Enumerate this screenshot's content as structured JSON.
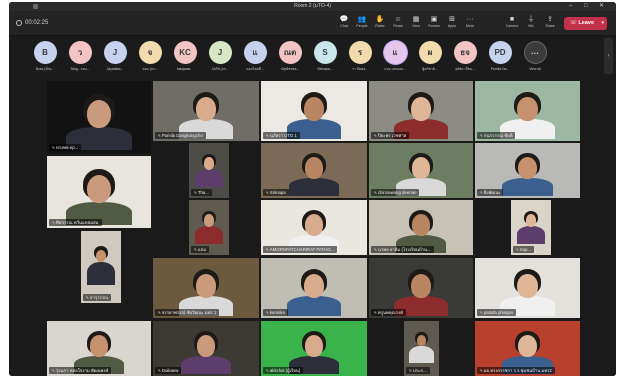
{
  "window": {
    "title": "Room 2 (มTO-4)"
  },
  "toolbar": {
    "timer": "00:02:25",
    "tools": [
      {
        "name": "chat",
        "icon": "chat-icon",
        "glyph": "💬",
        "label": "Chat"
      },
      {
        "name": "people",
        "icon": "people-icon",
        "glyph": "👥",
        "label": "People"
      },
      {
        "name": "raise",
        "icon": "hand-icon",
        "glyph": "✋",
        "label": "Raise"
      },
      {
        "name": "react",
        "icon": "smile-icon",
        "glyph": "☺",
        "label": "React"
      },
      {
        "name": "view",
        "icon": "grid-icon",
        "glyph": "▦",
        "label": "View"
      },
      {
        "name": "rooms",
        "icon": "rooms-icon",
        "glyph": "▣",
        "label": "Rooms"
      },
      {
        "name": "apps",
        "icon": "apps-icon",
        "glyph": "⊞",
        "label": "Apps"
      },
      {
        "name": "more",
        "icon": "more-icon",
        "glyph": "···",
        "label": "More"
      },
      {
        "name": "camera",
        "icon": "camera-icon",
        "glyph": "■",
        "label": "Camera"
      },
      {
        "name": "mic",
        "icon": "mic-icon",
        "glyph": "⏚",
        "label": "Mic"
      },
      {
        "name": "share",
        "icon": "share-icon",
        "glyph": "⇪",
        "label": "Share"
      }
    ],
    "leave_label": "Leave"
  },
  "strip": {
    "avatars": [
      {
        "initials": "B",
        "color": "#c7d2ef",
        "name": "Boss (Sho..."
      },
      {
        "initials": "ว",
        "color": "#f3c4c4",
        "name": "Tang...รอบ..."
      },
      {
        "initials": "J",
        "color": "#c7d2ef",
        "name": "Jaywalka..."
      },
      {
        "initials": "จ",
        "color": "#f2dcae",
        "name": "จอม (จร..."
      },
      {
        "initials": "KC",
        "color": "#f3c4c4",
        "name": "kanyawa..."
      },
      {
        "initials": "J",
        "color": "#d8e8c6",
        "name": "JAPA (จร..."
      },
      {
        "initials": "แ",
        "color": "#c7d2ef",
        "name": "แอมไพลดี..."
      },
      {
        "initials": "ณต",
        "color": "#f3c4c4",
        "name": "ณัฐพัชรพล..."
      },
      {
        "initials": "S",
        "color": "#c9e6ea",
        "name": "Sirinapa..."
      },
      {
        "initials": "ร",
        "color": "#f2dcae",
        "name": "รา บั้มตอ..."
      },
      {
        "initials": "แ",
        "color": "#e6c6ec",
        "name": "แจม แสงมณ..."
      },
      {
        "initials": "ผ",
        "color": "#f2dcae",
        "name": "ผู้อภิชาติ..."
      },
      {
        "initials": "ธจ",
        "color": "#f3c4c4",
        "name": "ธุติพร เจียม..."
      },
      {
        "initials": "PD",
        "color": "#c7d2ef",
        "name": "Pumila Da..."
      },
      {
        "initials": "···",
        "color": "#3b3b3b",
        "name": "View all"
      }
    ]
  },
  "tiles": [
    {
      "label": "ทรงพล ep...",
      "bg": "#121212"
    },
    {
      "label": "Pumila Dangkongcho",
      "bg": "#6f6d66"
    },
    {
      "label": "นภัสรา UTO 1",
      "bg": "#ece9e4"
    },
    {
      "label": "ปิยะพร เวชศาส",
      "bg": "#8c8b84"
    },
    {
      "label": "กนกวรรณ ชัยดี",
      "bg": "#9cb8a2"
    },
    {
      "label": "ทิพวรรณ หวั่นแหลมสม",
      "bg": "#e8e4de"
    },
    {
      "label": "Tha...",
      "bg": "#4e4c46"
    },
    {
      "label": "Sirinapa",
      "bg": "#7b6a55"
    },
    {
      "label": "chinnawong deenan",
      "bg": "#6d7d62"
    },
    {
      "label": "ยิ่งพัฒนะ",
      "bg": "#b9bab7"
    },
    {
      "label": "แจ่ม",
      "bg": "#5f5a50"
    },
    {
      "label": "AMORNPATCHARIRAT PATHO...",
      "bg": "#eae7e1"
    },
    {
      "label": "นวพล ยาอิ่ม (โรงเรียนบ้าน...",
      "bg": "#c7c2b6"
    },
    {
      "label": "Sup...",
      "bg": "#d9d3c8"
    },
    {
      "label": "จารุวรรณ",
      "bg": "#cfc9bf"
    },
    {
      "label": "จรรยาพรรณ์ ชัยวัฒนะ มทร 1",
      "bg": "#6b5a3e"
    },
    {
      "label": "kannika",
      "bg": "#c0bdb5"
    },
    {
      "label": "ครูนพคุณรงค์",
      "bg": "#3a3a36"
    },
    {
      "label": "patsda phimjan",
      "bg": "#e4e1dd"
    },
    {
      "label": "รุ่งนภา หล่อใจงาม พัฒนพงษ์",
      "bg": "#d9d6cf"
    },
    {
      "label": "Doikaew",
      "bg": "#3c3a33"
    },
    {
      "label": "akkchai (ผู้เรียน)",
      "bg": "#39b34a"
    },
    {
      "label": "ประภ...",
      "bg": "#5e5a52"
    },
    {
      "label": "ผอ.ทรงกรรชรา ร.ร.ชุมชนบ้าน มทร2",
      "bg": "#b8412e"
    }
  ]
}
